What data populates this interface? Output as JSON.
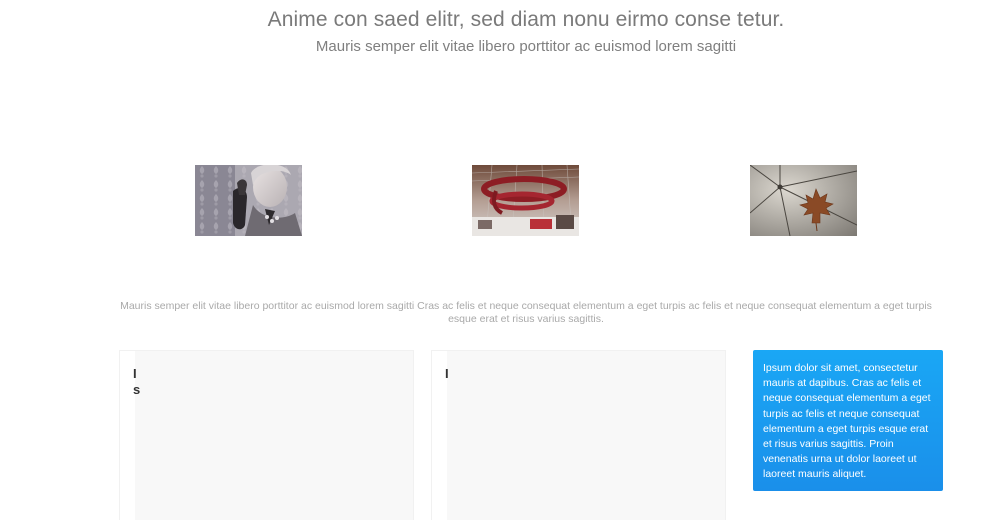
{
  "hero": {
    "title": "Anime con saed elitr, sed diam nonu eirmo conse tetur.",
    "subtitle": "Mauris semper elit vitae libero porttitor ac euismod lorem sagitti"
  },
  "gallery": {
    "images": [
      {
        "name": "woman-portrait-image"
      },
      {
        "name": "red-spiral-architecture-image"
      },
      {
        "name": "maple-leaf-umbrella-image"
      }
    ]
  },
  "description": "Mauris semper elit vitae libero porttitor ac euismod lorem sagitti Cras ac felis et neque consequat elementum a eget turpis ac felis et neque consequat elementum a eget turpis esque erat et risus varius sagittis.",
  "cards": [
    {
      "line1": "I",
      "line2": "s"
    },
    {
      "line1": "I"
    }
  ],
  "info_card": {
    "text": "Ipsum dolor sit amet, consectetur mauris at dapibus. Cras ac felis et neque consequat elementum a eget turpis ac felis et neque consequat elementum a eget turpis esque erat et risus varius sagittis. Proin venenatis urna ut dolor laoreet ut laoreet mauris aliquet.",
    "background": "#1a9cf0"
  }
}
